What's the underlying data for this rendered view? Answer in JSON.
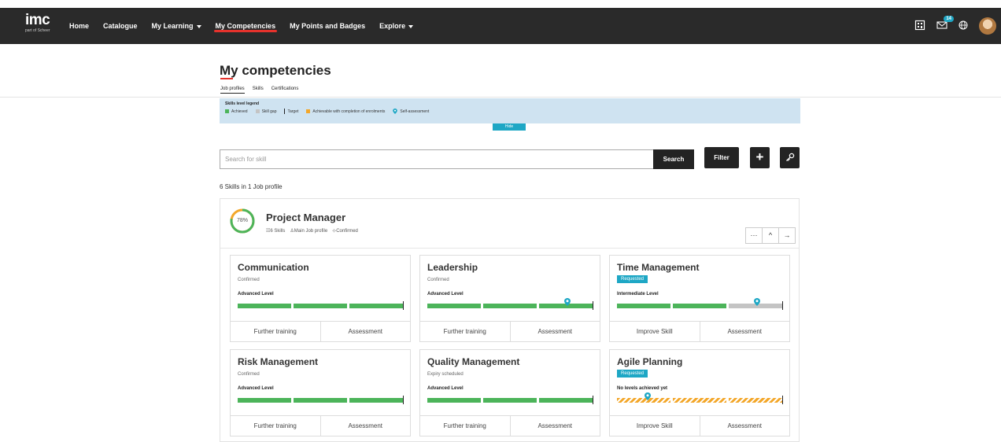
{
  "brand": {
    "name": "imc",
    "sub": "part of Scheer"
  },
  "nav": {
    "items": [
      {
        "label": "Home"
      },
      {
        "label": "Catalogue"
      },
      {
        "label": "My Learning"
      },
      {
        "label": "My Competencies"
      },
      {
        "label": "My Points and Badges"
      },
      {
        "label": "Explore"
      }
    ],
    "active": "My Competencies",
    "messages_badge": "14"
  },
  "page": {
    "title": "My competencies",
    "tabs": [
      {
        "label": "Job profiles"
      },
      {
        "label": "Skills"
      },
      {
        "label": "Certifications"
      }
    ],
    "active_tab": "Job profiles"
  },
  "legend": {
    "title": "Skills level legend",
    "items": {
      "achieved": "Achieved",
      "skill_gap": "Skill gap",
      "target": "Target",
      "achievable": "Achievable with completion of enrolments",
      "self_assessment": "Self-assessment"
    },
    "hide_label": "Hide",
    "colors": {
      "achieved": "#4cb45a",
      "skill_gap": "#c4c4c4",
      "achievable": "#f3a72a",
      "self_assessment": "#1ea7c5"
    }
  },
  "search": {
    "placeholder": "Search for skill",
    "search_label": "Search",
    "filter_label": "Filter",
    "add_label": "+",
    "assess_icon": "key-icon"
  },
  "summary": "6 Skills in 1 Job profile",
  "profile": {
    "title": "Project Manager",
    "progress_label": "78%",
    "progress": 0.78,
    "skills_count": "6 Skills",
    "type": "Main Job profile",
    "status": "Confirmed",
    "buttons": {
      "more": "···",
      "collapse": "^",
      "open": "→"
    }
  },
  "cards": [
    {
      "title": "Communication",
      "status": "Confirmed",
      "requested": false,
      "level": "Advanced Level",
      "segments": [
        "achieved",
        "achieved",
        "achieved"
      ],
      "self_assessment": null,
      "actions": [
        "Further training",
        "Assessment"
      ]
    },
    {
      "title": "Leadership",
      "status": "Confirmed",
      "requested": false,
      "level": "Advanced Level",
      "segments": [
        "achieved",
        "achieved",
        "achieved"
      ],
      "self_assessment": 2.5,
      "actions": [
        "Further training",
        "Assessment"
      ]
    },
    {
      "title": "Time Management",
      "status": "Requested",
      "requested": true,
      "level": "Intermediate Level",
      "segments": [
        "achieved",
        "achieved",
        "gap"
      ],
      "self_assessment": 2.5,
      "actions": [
        "Improve Skill",
        "Assessment"
      ]
    },
    {
      "title": "Risk Management",
      "status": "Confirmed",
      "requested": false,
      "level": "Advanced Level",
      "segments": [
        "achieved",
        "achieved",
        "achieved"
      ],
      "self_assessment": null,
      "actions": [
        "Further training",
        "Assessment"
      ]
    },
    {
      "title": "Quality Management",
      "status": "Expiry scheduled",
      "requested": false,
      "level": "Advanced Level",
      "segments": [
        "achieved",
        "achieved",
        "achieved"
      ],
      "self_assessment": null,
      "actions": [
        "Further training",
        "Assessment"
      ]
    },
    {
      "title": "Agile Planning",
      "status": "Requested",
      "requested": true,
      "level": "No levels achieved yet",
      "segments": [
        "achievable",
        "achievable",
        "achievable"
      ],
      "self_assessment": 0.55,
      "actions": [
        "Improve Skill",
        "Assessment"
      ]
    }
  ]
}
